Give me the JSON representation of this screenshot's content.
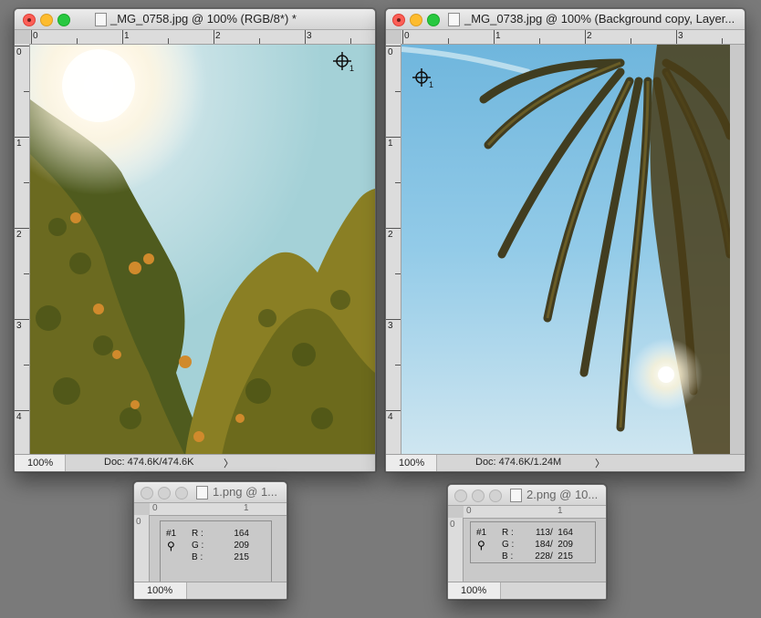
{
  "windows": {
    "left": {
      "title": "_MG_0758.jpg @ 100% (RGB/8*) *",
      "ruler_h": [
        "0",
        "1",
        "2",
        "3"
      ],
      "ruler_v": [
        "0",
        "1",
        "2",
        "3",
        "4"
      ],
      "zoom": "100%",
      "doc": "Doc: 474.6K/474.6K",
      "arrow": "〉",
      "sampler_label": "1"
    },
    "right": {
      "title": "_MG_0738.jpg @ 100% (Background copy, Layer...",
      "ruler_h": [
        "0",
        "1",
        "2",
        "3"
      ],
      "ruler_v": [
        "0",
        "1",
        "2",
        "3",
        "4"
      ],
      "zoom": "100%",
      "doc": "Doc: 474.6K/1.24M",
      "arrow": "〉",
      "sampler_label": "1"
    }
  },
  "info_panels": {
    "left": {
      "title": "1.png @ 1...",
      "ruler_h": [
        "0",
        "1"
      ],
      "ruler_v": [
        "0"
      ],
      "sampler": "#1",
      "r_label": "R :",
      "g_label": "G :",
      "b_label": "B :",
      "r": "164",
      "g": "209",
      "b": "215",
      "zoom": "100%"
    },
    "right": {
      "title": "2.png @ 10...",
      "ruler_h": [
        "0",
        "1"
      ],
      "ruler_v": [
        "0"
      ],
      "sampler": "#1",
      "r_label": "R :",
      "g_label": "G :",
      "b_label": "B :",
      "r": "113/  164",
      "g": "184/  209",
      "b": "228/  215",
      "zoom": "100%"
    }
  },
  "colors": {
    "desktop": "#7a7a7a",
    "sky_left": "#a4d1d7",
    "sky_right": "#71b8e4"
  },
  "icons": [
    "close-light",
    "minimize-light",
    "zoom-light",
    "document-icon",
    "color-sampler-icon",
    "eyedropper-icon",
    "chevron-right-icon"
  ]
}
